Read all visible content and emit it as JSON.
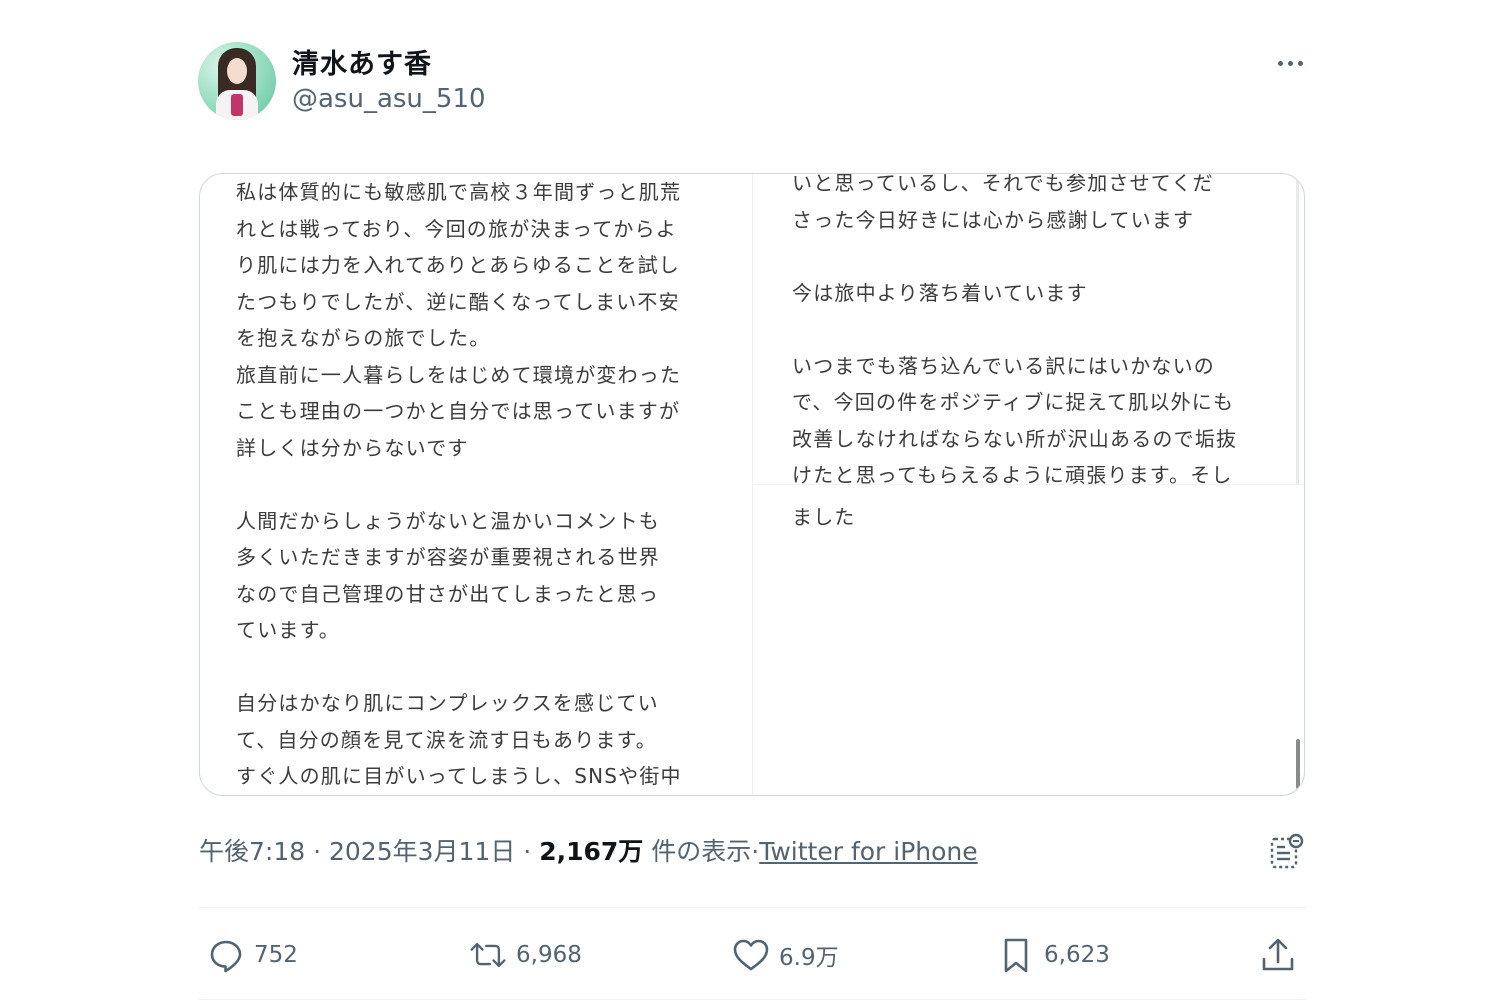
{
  "author": {
    "display_name": "清水あす香",
    "handle": "@asu_asu_510"
  },
  "media": {
    "left_column": [
      "私は体質的にも敏感肌で高校３年間ずっと肌荒",
      "れとは戦っており、今回の旅が決まってからよ",
      "り肌には力を入れてありとあらゆることを試し",
      "たつもりでしたが、逆に酷くなってしまい不安",
      "を抱えながらの旅でした。",
      "旅直前に一人暮らしをはじめて環境が変わった",
      "ことも理由の一つかと自分では思っていますが",
      "詳しくは分からないです",
      "",
      "人間だからしょうがないと温かいコメントも",
      "多くいただきますが容姿が重要視される世界",
      "なので自己管理の甘さが出てしまったと思っ",
      "ています。",
      "",
      "自分はかなり肌にコンプレックスを感じてい",
      "て、自分の顔を見て涙を流す日もあります。",
      "すぐ人の肌に目がいってしまうし、SNSや街中"
    ],
    "right_column": [
      "いと思っているし、それでも参加させてくだ",
      "さった今日好きには心から感謝しています",
      "",
      "今は旅中より落ち着いています",
      "",
      "いつまでも落ち込んでいる訳にはいかないの",
      "で、今回の件をポジティブに捉えて肌以外にも",
      "改善しなければならない所が沢山あるので垢抜",
      "けたと思ってもらえるように頑張ります。そし"
    ],
    "right_column_tail": "ました"
  },
  "meta": {
    "time": "午後7:18",
    "date": "2025年3月11日",
    "views_count": "2,167万",
    "views_label": "件の表示",
    "client": "Twitter for iPhone"
  },
  "actions": {
    "replies": "752",
    "retweets": "6,968",
    "likes": "6.9万",
    "bookmarks": "6,623"
  }
}
